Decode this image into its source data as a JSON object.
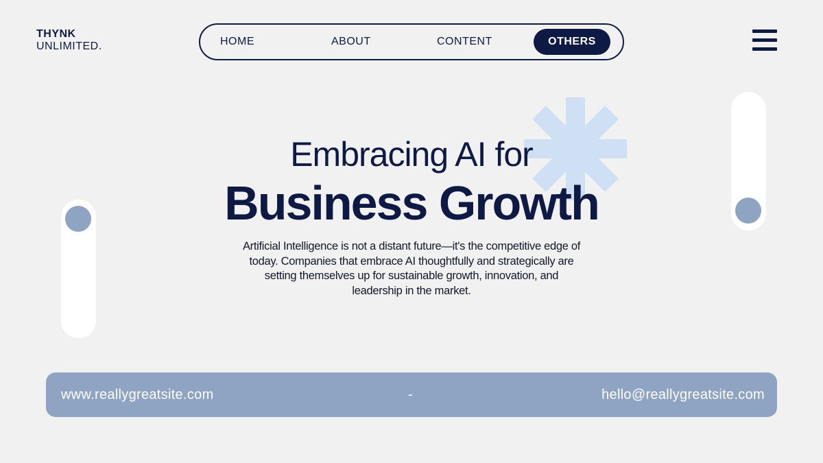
{
  "brand": {
    "line1": "THYNK",
    "line2": "UNLIMITED."
  },
  "nav": {
    "items": [
      {
        "label": "HOME",
        "active": false
      },
      {
        "label": "ABOUT",
        "active": false
      },
      {
        "label": "CONTENT",
        "active": false
      },
      {
        "label": "OTHERS",
        "active": true
      }
    ]
  },
  "menu": {
    "icon": "hamburger-menu-icon"
  },
  "hero": {
    "subtitle": "Embracing AI for",
    "title": "Business Growth",
    "body": "Artificial Intelligence is not a distant future—it's the competitive edge of today. Companies that embrace AI thoughtfully and strategically are setting themselves up for sustainable growth, innovation, and leadership in the market."
  },
  "decor": {
    "asterisk_icon": "asterisk-icon",
    "asterisk_color": "#cfe0f5",
    "toggle_color": "#8fa4c3"
  },
  "footer": {
    "website": "www.reallygreatsite.com",
    "separator": "-",
    "email": "hello@reallygreatsite.com"
  },
  "colors": {
    "primary": "#0f1a44",
    "background": "#f1f1f1",
    "accent": "#8fa4c3",
    "asterisk": "#cfe0f5"
  }
}
